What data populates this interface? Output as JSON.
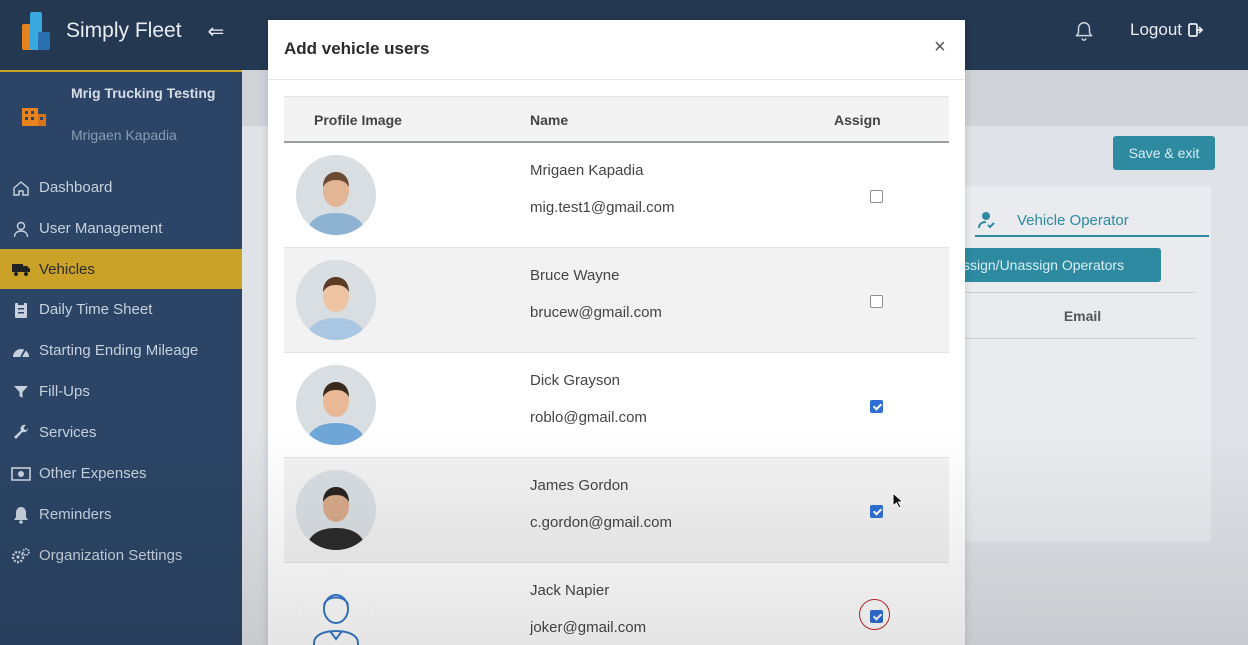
{
  "app": {
    "name": "Simply Fleet",
    "logout_label": "Logout"
  },
  "colors": {
    "topbar": "#243852",
    "sidebar": "#2c4566",
    "active": "#c9a227",
    "accent": "#2d8aa1",
    "checkbox": "#2f6fd6"
  },
  "organization": {
    "name": "Mrig Trucking Testing",
    "user": "Mrigaen Kapadia"
  },
  "sidebar": {
    "items": [
      {
        "label": "Dashboard",
        "icon": "home-icon",
        "active": false
      },
      {
        "label": "User Management",
        "icon": "user-icon",
        "active": false
      },
      {
        "label": "Vehicles",
        "icon": "truck-icon",
        "active": true
      },
      {
        "label": "Daily Time Sheet",
        "icon": "clipboard-icon",
        "active": false
      },
      {
        "label": "Starting Ending Mileage",
        "icon": "gauge-icon",
        "active": false
      },
      {
        "label": "Fill-Ups",
        "icon": "funnel-icon",
        "active": false
      },
      {
        "label": "Services",
        "icon": "wrench-icon",
        "active": false
      },
      {
        "label": "Other Expenses",
        "icon": "money-icon",
        "active": false
      },
      {
        "label": "Reminders",
        "icon": "bell-icon",
        "active": false
      },
      {
        "label": "Organization Settings",
        "icon": "gears-icon",
        "active": false
      }
    ]
  },
  "background": {
    "save_exit_label": "Save & exit",
    "tab_label": "Vehicle Operator",
    "assign_button_label": "ssign/Unassign Operators",
    "email_header": "Email"
  },
  "modal": {
    "title": "Add vehicle users",
    "close_label": "×",
    "columns": {
      "profile": "Profile Image",
      "name": "Name",
      "assign": "Assign"
    },
    "users": [
      {
        "name": "Mrigaen Kapadia",
        "email": "mig.test1@gmail.com",
        "assigned": false
      },
      {
        "name": "Bruce Wayne",
        "email": "brucew@gmail.com",
        "assigned": false
      },
      {
        "name": "Dick Grayson",
        "email": "roblo@gmail.com",
        "assigned": true
      },
      {
        "name": "James Gordon",
        "email": "c.gordon@gmail.com",
        "assigned": true
      },
      {
        "name": "Jack Napier",
        "email": "joker@gmail.com",
        "assigned": true
      }
    ]
  }
}
